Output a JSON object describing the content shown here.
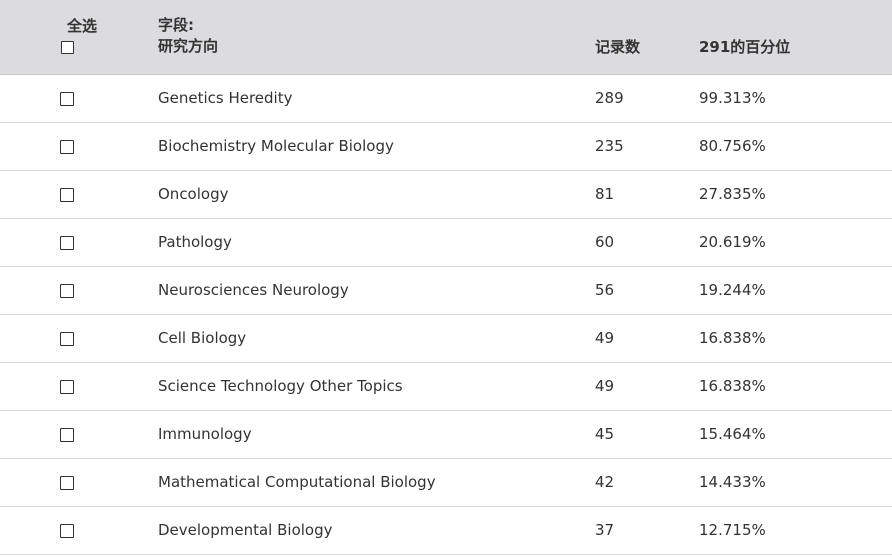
{
  "header": {
    "select_all_label": "全选",
    "field_label_line1": "字段:",
    "field_label_line2": "研究方向",
    "count_label": "记录数",
    "percent_label": "291的百分位"
  },
  "rows": [
    {
      "name": "Genetics Heredity",
      "count": "289",
      "percent": "99.313%"
    },
    {
      "name": "Biochemistry Molecular Biology",
      "count": "235",
      "percent": "80.756%"
    },
    {
      "name": "Oncology",
      "count": "81",
      "percent": "27.835%"
    },
    {
      "name": "Pathology",
      "count": "60",
      "percent": "20.619%"
    },
    {
      "name": "Neurosciences Neurology",
      "count": "56",
      "percent": "19.244%"
    },
    {
      "name": "Cell Biology",
      "count": "49",
      "percent": "16.838%"
    },
    {
      "name": "Science Technology Other Topics",
      "count": "49",
      "percent": "16.838%"
    },
    {
      "name": "Immunology",
      "count": "45",
      "percent": "15.464%"
    },
    {
      "name": "Mathematical Computational Biology",
      "count": "42",
      "percent": "14.433%"
    },
    {
      "name": "Developmental Biology",
      "count": "37",
      "percent": "12.715%"
    }
  ]
}
